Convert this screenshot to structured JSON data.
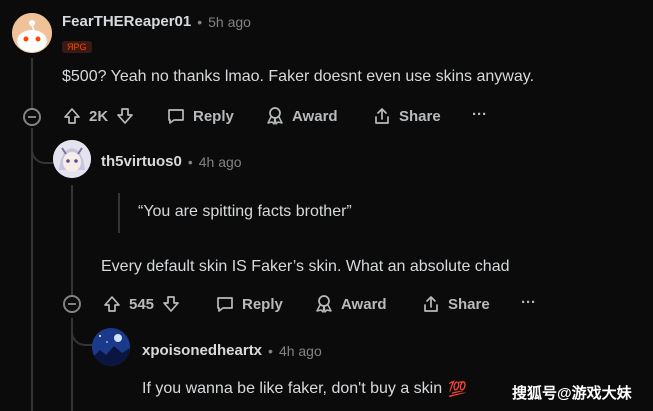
{
  "comments": [
    {
      "username": "FearTHEReaper01",
      "time": "5h ago",
      "badge": "ЯPG",
      "text": "$500? Yeah no thanks lmao. Faker doesnt even use skins anyway.",
      "votes": "2K"
    },
    {
      "username": "th5virtuos0",
      "time": "4h ago",
      "quote": "“You are spitting facts brother”",
      "text": "Every default skin IS Faker’s skin. What an absolute chad",
      "votes": "545"
    },
    {
      "username": "xpoisonedheartx",
      "time": "4h ago",
      "text": "If you wanna be like faker, don't buy a skin",
      "emoji": "💯"
    }
  ],
  "actions": {
    "reply": "Reply",
    "award": "Award",
    "share": "Share",
    "more": "···"
  },
  "meta_separator": "•",
  "watermark": "搜狐号@游戏大妹",
  "colors": {
    "background": "#0b0b0c",
    "text": "#d7dadc",
    "muted": "#818384",
    "thread_line": "#343536"
  }
}
